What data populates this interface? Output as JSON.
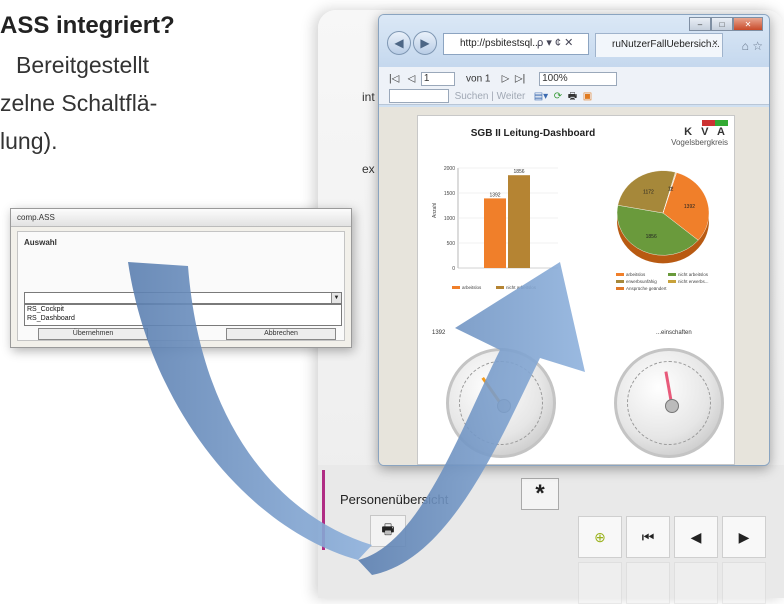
{
  "slide": {
    "headline": "ASS integriert?",
    "line1": "Bereitgestellt",
    "line2": "zelne Schaltflä-",
    "line3": "lung)."
  },
  "background_app": {
    "labels": [
      "int",
      "ex"
    ],
    "tab_label": "Personenübersicht",
    "star_label": "*",
    "nav_buttons": [
      "⊕",
      "⏮",
      "◀",
      "▶"
    ]
  },
  "browser": {
    "address": "http://psbitestsql...",
    "address_icons": "ρ ▾ ¢ ✕",
    "tab_title": "ruNutzerFallUebersich...",
    "tab_close": "×",
    "toolbar": {
      "first": "|◁",
      "prev": "◁",
      "page": "1",
      "of": "von 1",
      "next": "▷",
      "last": "▷|",
      "zoom": "100%",
      "search": "Suchen",
      "sep": "|",
      "next_link": "Weiter"
    }
  },
  "report": {
    "title": "SGB II Leitung-Dashboard",
    "logo_main": "K V A",
    "logo_sub": "Vogelsbergkreis",
    "gauge_left_label": "1392",
    "gauge_right_label": "...einschaften"
  },
  "chart_data": [
    {
      "type": "bar",
      "categories": [
        "arbeitslos",
        "nicht arbeitslos"
      ],
      "values": [
        1392,
        1856
      ],
      "ylim": [
        0,
        2000
      ],
      "ylabel": "Anzahl",
      "yticks": [
        0,
        500,
        1000,
        1500,
        2000
      ],
      "series_colors": [
        "#f07f2a",
        "#b58433"
      ]
    },
    {
      "type": "pie",
      "slices": [
        {
          "label": "arbeitslos",
          "value": 1392,
          "color": "#f07f2a"
        },
        {
          "label": "nicht arbeitslos",
          "value": 1856,
          "color": "#6a9a3c"
        },
        {
          "label": "erwerbsunfähig",
          "value": 1172,
          "color": "#a6883a"
        },
        {
          "label": "",
          "value": 12,
          "color": "#c8a23b"
        },
        {
          "label": "",
          "value": 7,
          "color": "#e0782a"
        }
      ],
      "legend": [
        "arbeitslos",
        "nicht arbeitslos",
        "erwerbsunfähig",
        "nicht erwerbs...",
        "Ansprüche geändert"
      ]
    }
  ],
  "dialog": {
    "title": "comp.ASS",
    "label": "Auswahl",
    "options": [
      "RS_Cockpit",
      "RS_Dashboard"
    ],
    "ok": "Übernehmen",
    "cancel": "Abbrechen"
  }
}
